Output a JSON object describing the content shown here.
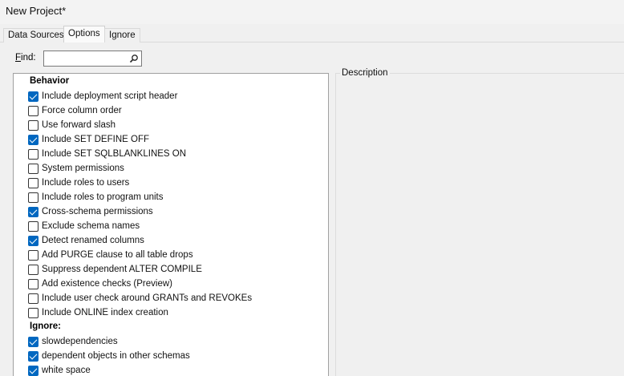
{
  "window": {
    "title": "New Project*"
  },
  "tabs": [
    {
      "label": "Data Sources",
      "active": false
    },
    {
      "label": "Options",
      "active": true
    },
    {
      "label": "Ignore",
      "active": false
    }
  ],
  "find": {
    "label_accel": "F",
    "label_rest": "ind:",
    "value": ""
  },
  "description": {
    "label": "Description"
  },
  "groups": [
    {
      "header": "Behavior",
      "options": [
        {
          "label": "Include deployment script header",
          "checked": true
        },
        {
          "label": "Force column order",
          "checked": false
        },
        {
          "label": "Use forward slash",
          "checked": false
        },
        {
          "label": "Include SET DEFINE OFF",
          "checked": true
        },
        {
          "label": "Include SET SQLBLANKLINES ON",
          "checked": false
        },
        {
          "label": "System permissions",
          "checked": false
        },
        {
          "label": "Include roles to users",
          "checked": false
        },
        {
          "label": "Include roles to program units",
          "checked": false
        },
        {
          "label": "Cross-schema permissions",
          "checked": true
        },
        {
          "label": "Exclude schema names",
          "checked": false
        },
        {
          "label": "Detect renamed columns",
          "checked": true
        },
        {
          "label": "Add PURGE clause to all table drops",
          "checked": false
        },
        {
          "label": "Suppress dependent ALTER COMPILE",
          "checked": false
        },
        {
          "label": "Add existence checks (Preview)",
          "checked": false
        },
        {
          "label": "Include user check around GRANTs and REVOKEs",
          "checked": false
        },
        {
          "label": "Include ONLINE index creation",
          "checked": false
        }
      ]
    },
    {
      "header": "Ignore:",
      "options": [
        {
          "label": "slowdependencies",
          "checked": true
        },
        {
          "label": "dependent objects in other schemas",
          "checked": true
        },
        {
          "label": "white space",
          "checked": true
        }
      ]
    }
  ]
}
